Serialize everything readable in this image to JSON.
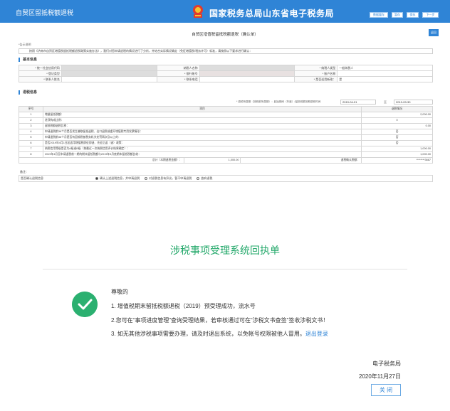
{
  "header": {
    "left_title": "自贸区留抵税额退税",
    "site_title": "国家税务总局山东省电子税务局",
    "buttons": [
      "数据缓存",
      "暂存",
      "保存",
      "下一步"
    ]
  },
  "form": {
    "title": "自贸区增值税留抵税额退税（确认单）",
    "side_button": "返回",
    "note_label": "*告示说明",
    "notice": "按照《济南市自贸区增值税留抵税额退税政策实施办法》，我们对您申请退税的情况进行了分析，并结合实际情况确定（免征增值税/税务许可）标准，请按照以下要求进行确认：",
    "section_basic": "基本信息",
    "basic_rows": [
      [
        "* 统一社会信用代码",
        "",
        "纳税人名称",
        "",
        "* 纳税人类型",
        "一般纳税人"
      ],
      [
        "* 登记类型",
        "",
        "* 银行账号",
        "",
        "* 账户名称",
        ""
      ],
      [
        "* 联系人姓名",
        "",
        "* 联系电话",
        "",
        "* 是否适用新政：",
        "是"
      ]
    ],
    "section_refund": "退税信息",
    "period_label": "* 退税所属期（按税款所属期）：起始期间（年度）/留抵税额到期退税时间",
    "period_start": "2019-04-01",
    "period_to": "至",
    "period_end": "2019-09-30",
    "table_headers": [
      "序号",
      "项目",
      "退税情况"
    ],
    "table_rows": [
      [
        "1",
        "增量留抵税额：",
        "2,000.00"
      ],
      [
        "2",
        "进项构成比例：",
        "0"
      ],
      [
        "3",
        "留抵税额退税比例：",
        "0.00"
      ],
      [
        "4",
        "申请退税前36个月是否发生骗取留抵退税、出口退税或虚开增值税专用发票情形：",
        "否"
      ],
      [
        "5",
        "申请退税前36个月是否有因偷税被税务机关处罚两次及以上的：",
        "否"
      ],
      [
        "6",
        "是否2019年4月1日起适用增值税即征即退、先征后返（退）政策：",
        "否"
      ],
      [
        "7",
        "纳税信用等级是否为A级或B级（按最近一次纳税信用评价结果确定）：",
        "1,000.00"
      ],
      [
        "8",
        "2019年4月至申请退税前一期的期末留抵税额与2019年3月底期末留抵税额比较：",
        "1,000.00"
      ]
    ],
    "total_row": {
      "label": "总计（本期退税金额）：",
      "amount": "1,000.00",
      "sign_label": "退税确认税额：",
      "sign_value": "********3667"
    },
    "remark_label": "备注：",
    "radio_label": "是否确认退税信息",
    "radio_options": [
      "确认上述退税信息，并申请退税",
      "对退税信息有异议，暂不申请退税",
      "放弃退税"
    ]
  },
  "receipt": {
    "title": "涉税事项受理系统回执单",
    "greeting": "尊敬的",
    "line1": "1. 增值税期末留抵税额退税（2019）预受理成功，流水号",
    "line2": "2.您可在“事项进度管理”查询受理结果，若审核通过可在“涉税文书查签”签收涉税文书！",
    "line3_prefix": "3. 如无其他涉税事项需要办理，请及时退出系统，以免帐号权限被他人冒用。",
    "logout_link": "退出登录",
    "org": "电子税务局",
    "date": "2020年11月27日",
    "close_label": "关 闭"
  },
  "colors": {
    "header_blue": "#2f84d6",
    "success_green": "#2bb070",
    "title_green": "#23a86a"
  }
}
